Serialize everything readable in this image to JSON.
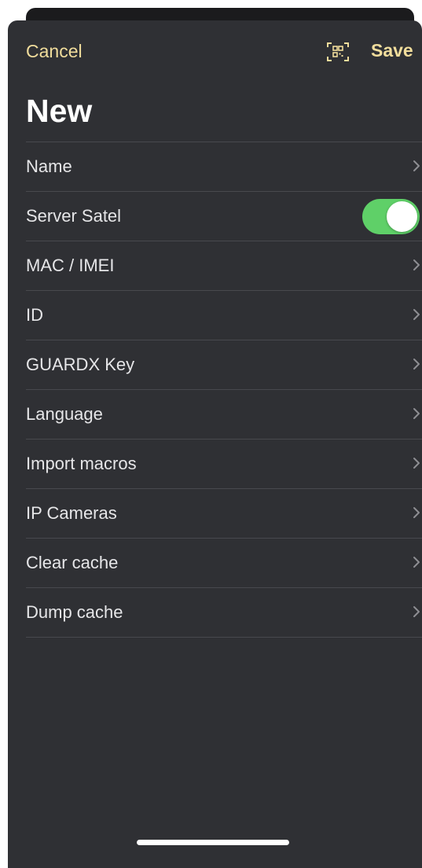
{
  "nav": {
    "cancel_label": "Cancel",
    "save_label": "Save",
    "qr_icon": "qr-scan-icon",
    "accent_color": "#f1dd9c"
  },
  "page": {
    "title": "New"
  },
  "settings": {
    "items": [
      {
        "label": "Name",
        "control": "chevron"
      },
      {
        "label": "Server Satel",
        "control": "toggle",
        "value": true
      },
      {
        "label": "MAC / IMEI",
        "control": "chevron"
      },
      {
        "label": "ID",
        "control": "chevron"
      },
      {
        "label": "GUARDX Key",
        "control": "chevron"
      },
      {
        "label": "Language",
        "control": "chevron"
      },
      {
        "label": "Import macros",
        "control": "chevron"
      },
      {
        "label": "IP Cameras",
        "control": "chevron"
      },
      {
        "label": "Clear cache",
        "control": "chevron"
      },
      {
        "label": "Dump cache",
        "control": "chevron"
      }
    ]
  },
  "colors": {
    "background": "#2f3034",
    "toggle_on": "#5fd068",
    "separator": "#48494e"
  }
}
